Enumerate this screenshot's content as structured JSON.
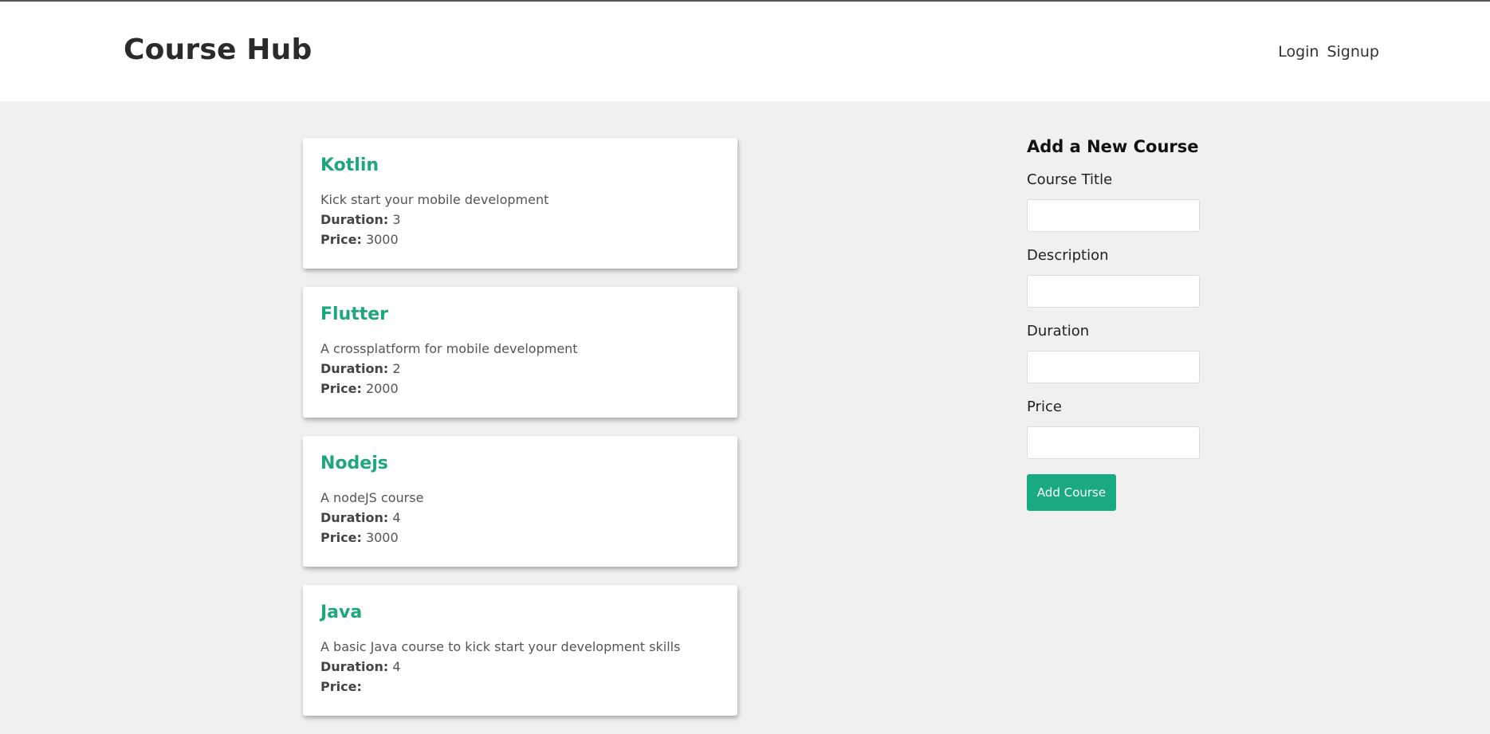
{
  "header": {
    "brand": "Course Hub",
    "nav": {
      "login": "Login",
      "signup": "Signup"
    }
  },
  "courses": [
    {
      "title": "Kotlin",
      "description": "Kick start your mobile development",
      "duration_label": "Duration:",
      "duration": "3",
      "price_label": "Price:",
      "price": "3000"
    },
    {
      "title": "Flutter",
      "description": "A crossplatform for mobile development",
      "duration_label": "Duration:",
      "duration": "2",
      "price_label": "Price:",
      "price": "2000"
    },
    {
      "title": "Nodejs",
      "description": "A nodeJS course",
      "duration_label": "Duration:",
      "duration": "4",
      "price_label": "Price:",
      "price": "3000"
    },
    {
      "title": "Java",
      "description": "A basic Java course to kick start your development skills",
      "duration_label": "Duration:",
      "duration": "4",
      "price_label": "Price:",
      "price": ""
    }
  ],
  "form": {
    "heading": "Add a New Course",
    "fields": [
      {
        "label": "Course Title",
        "value": ""
      },
      {
        "label": "Description",
        "value": ""
      },
      {
        "label": "Duration",
        "value": ""
      },
      {
        "label": "Price",
        "value": ""
      }
    ],
    "submit_label": "Add Course"
  },
  "colors": {
    "accent": "#1aaa82",
    "title_green": "#1ea77e",
    "background": "#f0f0f0"
  }
}
